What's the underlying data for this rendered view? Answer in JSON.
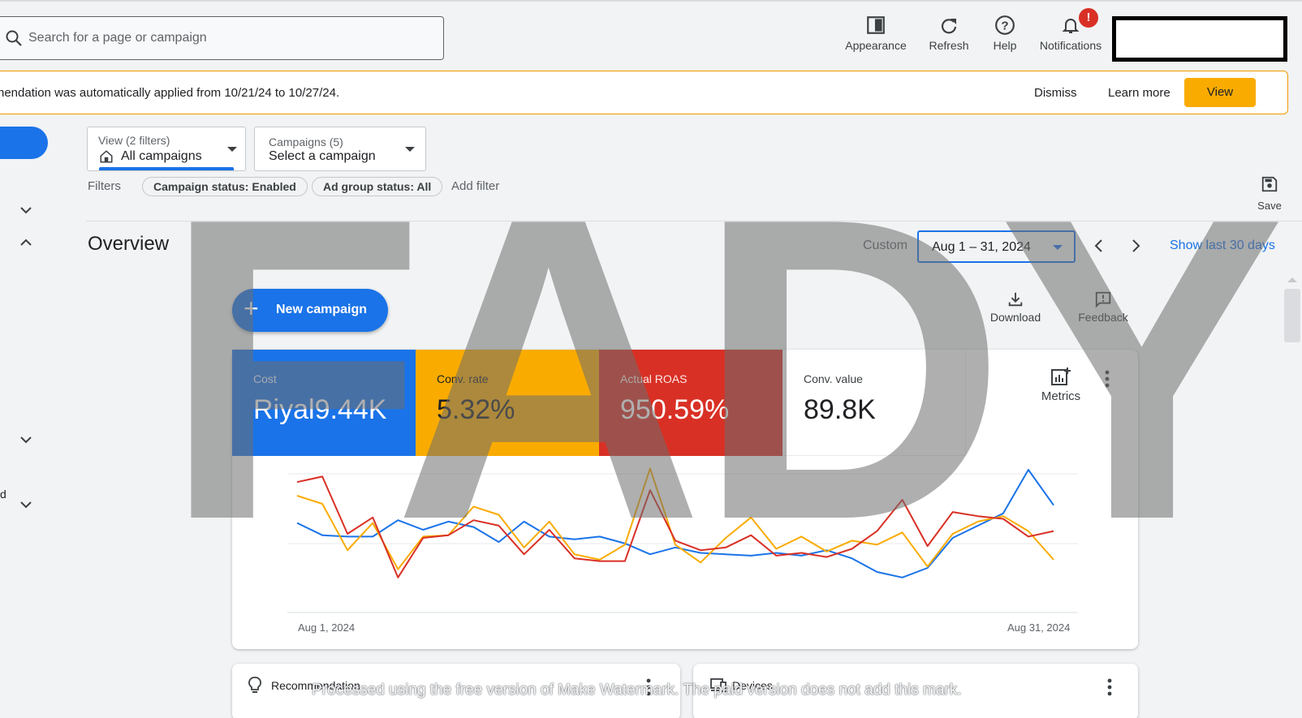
{
  "search": {
    "placeholder": "Search for a page or campaign"
  },
  "toolbar": {
    "appearance": "Appearance",
    "refresh": "Refresh",
    "help": "Help",
    "notifications": "Notifications",
    "notification_badge": "!"
  },
  "banner": {
    "message": "nendation was automatically applied from 10/21/24 to 10/27/24.",
    "dismiss": "Dismiss",
    "learn_more": "Learn more",
    "view": "View"
  },
  "view_picker": {
    "label": "View (2 filters)",
    "value": "All campaigns"
  },
  "campaign_picker": {
    "label": "Campaigns (5)",
    "value": "Select a campaign"
  },
  "filters": {
    "label": "Filters",
    "chips": [
      "Campaign status: Enabled",
      "Ad group status: All"
    ],
    "add": "Add filter"
  },
  "save_label": "Save",
  "sidebar": {
    "partial_label": "d"
  },
  "overview": {
    "title": "Overview",
    "custom_label": "Custom",
    "date_range": "Aug 1 – 31, 2024",
    "show_last": "Show last 30 days"
  },
  "new_campaign": "New campaign",
  "actions": {
    "download": "Download",
    "feedback": "Feedback"
  },
  "scorecards": [
    {
      "name": "Cost",
      "value": "Riyal9.44K",
      "color": "#1a73e8"
    },
    {
      "name": "Conv. rate",
      "value": "5.32%",
      "color": "#f9ab00"
    },
    {
      "name": "Actual ROAS",
      "value": "950.59%",
      "color": "#d93025"
    },
    {
      "name": "Conv. value",
      "value": "89.8K",
      "color": "#ffffff"
    }
  ],
  "metrics_label": "Metrics",
  "chart_data": {
    "type": "line",
    "x_start": "Aug 1, 2024",
    "x_end": "Aug 31, 2024",
    "x": [
      1,
      2,
      3,
      4,
      5,
      6,
      7,
      8,
      9,
      10,
      11,
      12,
      13,
      14,
      15,
      16,
      17,
      18,
      19,
      20,
      21,
      22,
      23,
      24,
      25,
      26,
      27,
      28,
      29,
      30,
      31
    ],
    "series": [
      {
        "color": "#1a73e8",
        "values": [
          0.58,
          0.49,
          0.48,
          0.48,
          0.6,
          0.53,
          0.59,
          0.55,
          0.44,
          0.59,
          0.48,
          0.46,
          0.48,
          0.43,
          0.35,
          0.4,
          0.36,
          0.35,
          0.34,
          0.36,
          0.34,
          0.38,
          0.32,
          0.22,
          0.18,
          0.25,
          0.47,
          0.56,
          0.65,
          0.97,
          0.71
        ]
      },
      {
        "color": "#f9ab00",
        "values": [
          0.78,
          0.72,
          0.38,
          0.58,
          0.24,
          0.48,
          0.49,
          0.7,
          0.64,
          0.4,
          0.59,
          0.35,
          0.31,
          0.42,
          0.98,
          0.42,
          0.29,
          0.47,
          0.62,
          0.39,
          0.48,
          0.37,
          0.45,
          0.42,
          0.51,
          0.26,
          0.5,
          0.59,
          0.63,
          0.52,
          0.31
        ]
      },
      {
        "color": "#d93025",
        "values": [
          0.88,
          0.92,
          0.5,
          0.62,
          0.18,
          0.47,
          0.49,
          0.6,
          0.56,
          0.35,
          0.53,
          0.32,
          0.3,
          0.3,
          0.82,
          0.45,
          0.38,
          0.4,
          0.49,
          0.34,
          0.36,
          0.33,
          0.39,
          0.52,
          0.75,
          0.41,
          0.66,
          0.63,
          0.61,
          0.48,
          0.52
        ]
      }
    ]
  },
  "bottom_cards": {
    "recommendation": "Recommendation",
    "devices": "Devices"
  },
  "watermark": {
    "big": "FADY",
    "text": "Processed using the free version of Make Watermark. The paid version does not add this mark."
  }
}
